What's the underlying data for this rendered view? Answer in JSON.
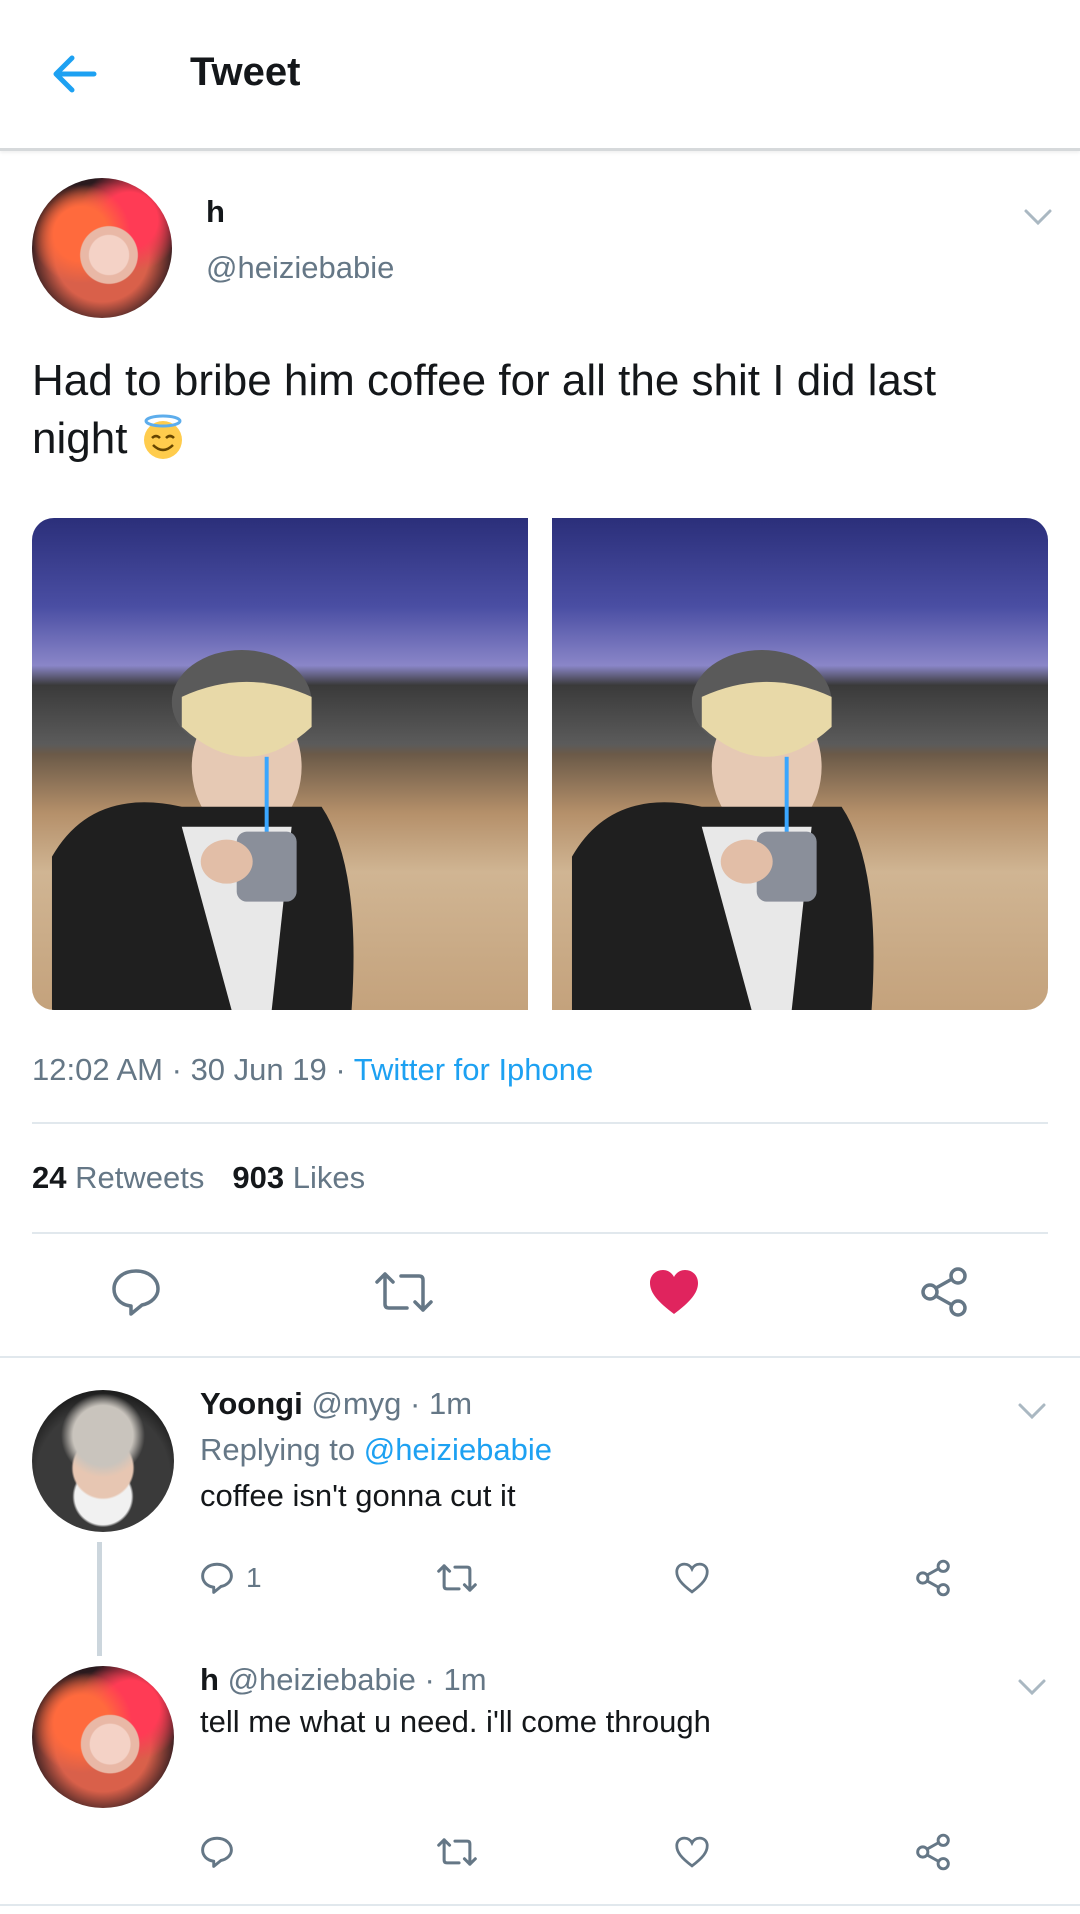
{
  "header": {
    "title": "Tweet"
  },
  "tweet": {
    "name": "h",
    "handle": "@heiziebabie",
    "text": "Had to bribe him coffee for all the shit I did last night",
    "time": "12:02 AM",
    "date": "30 Jun 19",
    "source": "Twitter for Iphone",
    "retweets": "24",
    "retweets_label": "Retweets",
    "likes": "903",
    "likes_label": "Likes",
    "liked": true,
    "accent": "#1da1f2",
    "like_color": "#e0245e"
  },
  "replies": [
    {
      "name": "Yoongi",
      "handle": "@myg",
      "time": "1m",
      "replying_label": "Replying to",
      "replying_to": "@heiziebabie",
      "text": "coffee isn't gonna cut it",
      "reply_count": "1"
    },
    {
      "name": "h",
      "handle": "@heiziebabie",
      "time": "1m",
      "text": "tell me what u need. i'll come through"
    }
  ],
  "separator": "·"
}
